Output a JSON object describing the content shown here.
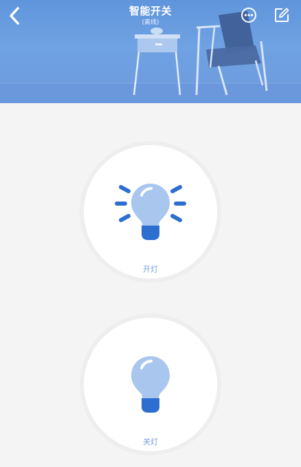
{
  "header": {
    "title": "智能开关",
    "subtitle": "(离线)",
    "back_icon": "chevron-left-icon",
    "more_icon": "more-circle-icon",
    "edit_icon": "edit-icon"
  },
  "controls": {
    "on_label": "开灯",
    "off_label": "关灯"
  },
  "colors": {
    "header_blue": "#6fa2e2",
    "bulb_light": "#a9c6ee",
    "bulb_base": "#2d6fd0",
    "label": "#6f9be0",
    "background": "#f4f4f4"
  }
}
